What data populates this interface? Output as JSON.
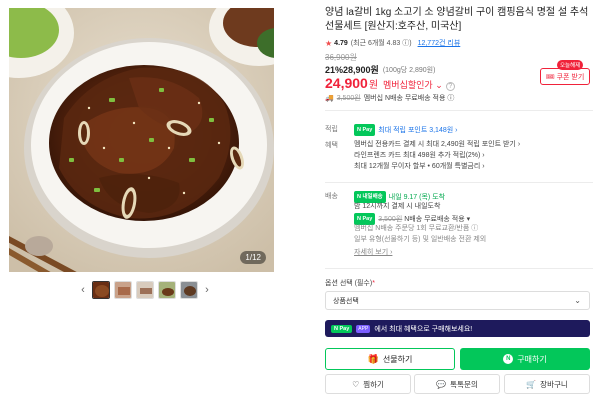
{
  "product": {
    "title": "양념 la갈비 1kg 소고기 소 양념갈비 구이 캠핑음식 명절 설 추석 선물세트 [원산지:호주산, 미국산]",
    "rating_score": "4.79",
    "rating_note": "(최근 6개월 4.83 ⓘ)",
    "review_count": "12,772건 리뷰",
    "photo_counter": "1/12"
  },
  "price": {
    "original": "36,900원",
    "discount_line": "21%28,900원",
    "unit_price": "(100g당 2,890원)",
    "final": "24,900",
    "final_won": "원",
    "promo_label": "멤버십할인가 ⌄",
    "coupon_tag": "오늘해제",
    "coupon_button": "쿠폰 받기",
    "ship_strike": "3,500원",
    "ship_text": "멤버십 N배송 무료배송 적용 ⓘ"
  },
  "details": {
    "points_label": "적립",
    "points_badge": "N Pay",
    "points_text": "최대 적립 포인트 3,148원 ›",
    "benefit_label": "혜택",
    "benefit_lines": [
      "멤버십 전용카드 결제 시 최대 2,490원 적립 포인트 받기 ›",
      "라인프렌즈 카드 최대 498원 추가 적립(2%) ›",
      "최대 12개월 무이자 할부 • 60개월 특별금리 ›"
    ],
    "delivery_label": "배송",
    "delivery_badge": "N 내일배송",
    "delivery_date": "내일 9.17 (목) 도착",
    "delivery_lines": [
      "밤 12시까지 결제 시 내일도착",
      "N배송 무료배송 적용 ▾",
      "멤버십 N배송 주문당 1회 무료교환/반품 ⓘ",
      "일부 유형(선물하기 등) 및 일반배송 전환 제외"
    ],
    "delivery_strike": "3,500원",
    "delivery_more": "자세히 보기 ›"
  },
  "option": {
    "label": "옵션 선택 (필수)",
    "required_mark": "*",
    "select_value": "상품선택"
  },
  "banner": {
    "badge": "N Pay",
    "badge2": "APP",
    "text": "에서 최대 혜택으로 구매해보세요!"
  },
  "buttons": {
    "gift": "선물하기",
    "buy": "구매하기",
    "wish": "찜하기",
    "talk": "톡톡문의",
    "cart": "장바구니"
  },
  "colors": {
    "accent_red": "#f0223a",
    "naver_green": "#03c75a",
    "banner_navy": "#1e1a5c"
  },
  "icons": [
    "star-icon",
    "truck-icon",
    "gift-icon",
    "naver-n-icon",
    "heart-icon",
    "chat-icon",
    "cart-icon",
    "chevron-down-icon",
    "chevron-left-icon",
    "chevron-right-icon"
  ]
}
